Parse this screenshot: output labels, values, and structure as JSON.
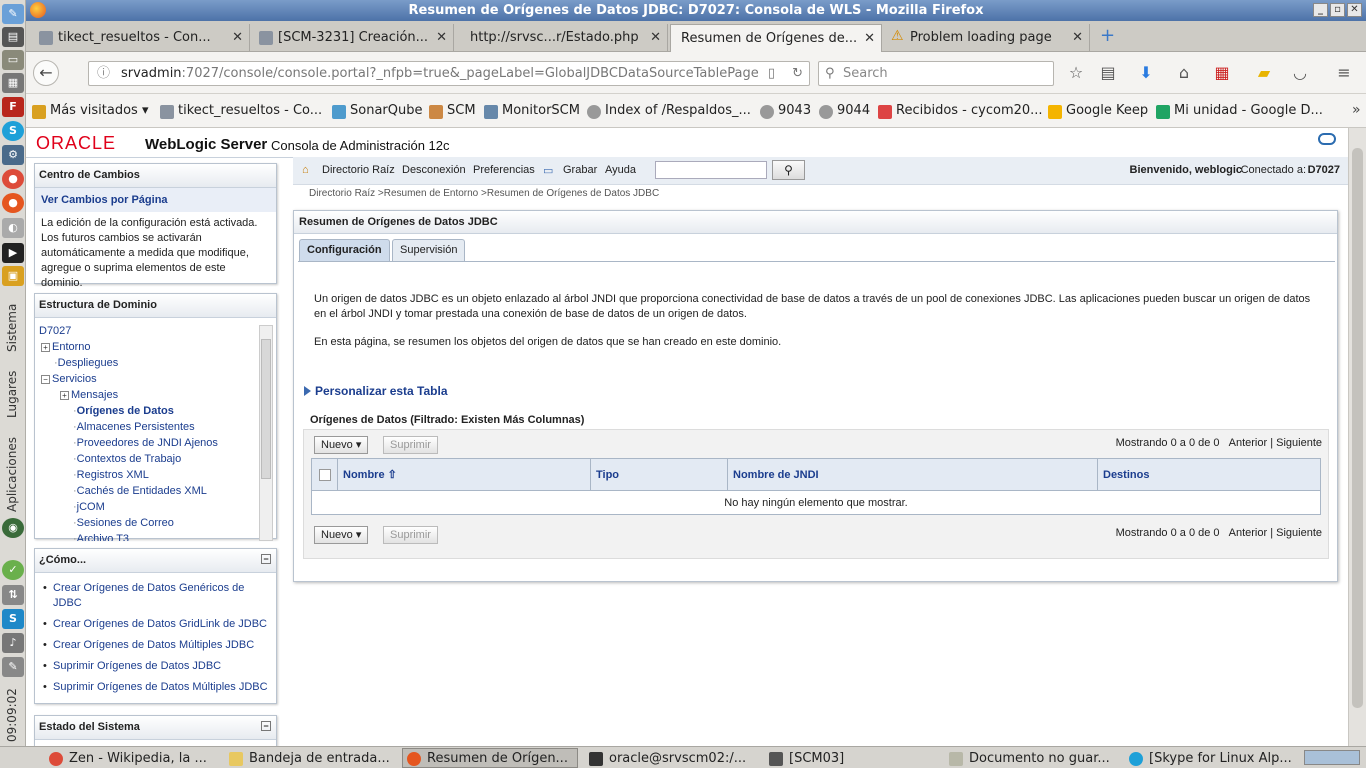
{
  "window": {
    "title": "Resumen de Orígenes de Datos JDBC: D7027: Consola de WLS - Mozilla Firefox"
  },
  "left_panel": {
    "labels": [
      "Sistema",
      "Lugares",
      "Aplicaciones"
    ],
    "clock": "09:09:02",
    "icons": [
      "pencil-icon",
      "terminal-icon",
      "folder-icon",
      "filezilla-icon",
      "skype-icon",
      "network-icon",
      "chrome-icon",
      "firefox-icon",
      "settings-icon",
      "console-icon",
      "user-icon"
    ]
  },
  "browser_tabs": [
    {
      "label": "tikect_resueltos - Con...",
      "icon": "page-icon"
    },
    {
      "label": "[SCM-3231] Creación...",
      "icon": "page-icon"
    },
    {
      "label": "http://srvsc...r/Estado.php",
      "icon": ""
    },
    {
      "label": "Resumen de Orígenes de...",
      "icon": ""
    },
    {
      "label": "Problem loading page",
      "icon": "warning-icon"
    }
  ],
  "nav": {
    "url_host": "srvadmin",
    "url_rest": ":7027/console/console.portal?_nfpb=true&_pageLabel=GlobalJDBCDataSourceTablePage",
    "search_placeholder": "Search"
  },
  "bookmarks": [
    {
      "label": "Más visitados ▾"
    },
    {
      "label": "tikect_resueltos - Co..."
    },
    {
      "label": "SonarQube"
    },
    {
      "label": "SCM"
    },
    {
      "label": "MonitorSCM"
    },
    {
      "label": "Index of /Respaldos_..."
    },
    {
      "label": "9043"
    },
    {
      "label": "9044"
    },
    {
      "label": "Recibidos - cycom20..."
    },
    {
      "label": "Google Keep"
    },
    {
      "label": "Mi unidad - Google D..."
    }
  ],
  "wls": {
    "oracle_logo": "ORACLE",
    "product": "WebLogic Server",
    "subtitle": "Consola de Administración 12c"
  },
  "change_center": {
    "title": "Centro de Cambios",
    "link": "Ver Cambios por Página",
    "text": "La edición de la configuración está activada. Los futuros cambios se activarán automáticamente a medida que modifique, agregue o suprima elementos de este dominio."
  },
  "domain_structure": {
    "title": "Estructura de Dominio",
    "items": [
      {
        "label": "D7027"
      },
      {
        "label": "Entorno"
      },
      {
        "label": "Despliegues"
      },
      {
        "label": "Servicios"
      },
      {
        "label": "Mensajes"
      },
      {
        "label": "Orígenes de Datos"
      },
      {
        "label": "Almacenes Persistentes"
      },
      {
        "label": "Proveedores de JNDI Ajenos"
      },
      {
        "label": "Contextos de Trabajo"
      },
      {
        "label": "Registros XML"
      },
      {
        "label": "Cachés de Entidades XML"
      },
      {
        "label": "jCOM"
      },
      {
        "label": "Sesiones de Correo"
      },
      {
        "label": "Archivo T3"
      }
    ]
  },
  "howto": {
    "title": "¿Cómo...",
    "items": [
      "Crear Orígenes de Datos Genéricos de JDBC",
      "Crear Orígenes de Datos GridLink de JDBC",
      "Crear Orígenes de Datos Múltiples JDBC",
      "Suprimir Orígenes de Datos JDBC",
      "Suprimir Orígenes de Datos Múltiples JDBC"
    ]
  },
  "system_status": {
    "title": "Estado del Sistema"
  },
  "topnav": {
    "home": "Directorio Raíz",
    "logout": "Desconexión",
    "prefs": "Preferencias",
    "record": "Grabar",
    "help": "Ayuda",
    "welcome": "Bienvenido, weblogic",
    "connected_label": "Conectado a:",
    "connected_value": "D7027"
  },
  "breadcrumb": "Directorio Raíz >Resumen de Entorno >Resumen de Orígenes de Datos JDBC",
  "main": {
    "title": "Resumen de Orígenes de Datos JDBC",
    "tabs": [
      "Configuración",
      "Supervisión"
    ],
    "para1": "Un origen de datos JDBC es un objeto enlazado al árbol JNDI que proporciona conectividad de base de datos a través de un pool de conexiones JDBC. Las aplicaciones pueden buscar un origen de datos en el árbol JNDI y tomar prestada una conexión de base de datos de un origen de datos.",
    "para2": "En esta página, se resumen los objetos del origen de datos que se han creado en este dominio.",
    "customize": "Personalizar esta Tabla",
    "table_title": "Orígenes de Datos (Filtrado: Existen Más Columnas)",
    "new_btn": "Nuevo ▾",
    "delete_btn": "Suprimir",
    "pager_text": "Mostrando 0 a 0 de 0",
    "prev": "Anterior",
    "next": "Siguiente",
    "columns": [
      "Nombre",
      "Tipo",
      "Nombre de JNDI",
      "Destinos"
    ],
    "empty": "No hay ningún elemento que mostrar."
  },
  "taskbar": [
    {
      "label": "Zen - Wikipedia, la ..."
    },
    {
      "label": "Bandeja de entrada..."
    },
    {
      "label": "Resumen de Orígen..."
    },
    {
      "label": "oracle@srvscm02:/..."
    },
    {
      "label": "[SCM03]"
    },
    {
      "label": "Documento no guar..."
    },
    {
      "label": "[Skype for Linux Alp..."
    }
  ]
}
